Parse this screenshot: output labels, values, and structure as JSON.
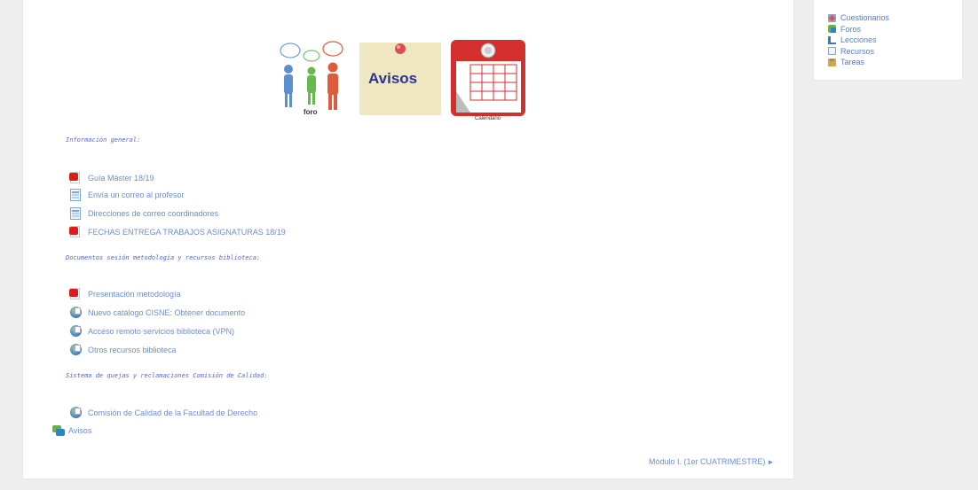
{
  "sidebar": {
    "items": [
      {
        "label": "Cuestionarios",
        "icon": "quiz-icon"
      },
      {
        "label": "Foros",
        "icon": "forum-icon"
      },
      {
        "label": "Lecciones",
        "icon": "lesson-icon"
      },
      {
        "label": "Recursos",
        "icon": "resource-icon"
      },
      {
        "label": "Tareas",
        "icon": "assignment-icon"
      }
    ]
  },
  "banner": {
    "foro_label": "foro",
    "avisos_label": "Avisos",
    "calendario_label": "Calendario"
  },
  "sections": [
    {
      "heading": "Información general:",
      "items": [
        {
          "label": "Guía Máster 18/19",
          "icon": "pdf-icon"
        },
        {
          "label": "Envía un correo al profesor",
          "icon": "page-icon"
        },
        {
          "label": "Direcciones de correo coordinadores",
          "icon": "page-icon"
        },
        {
          "label": "FECHAS ENTREGA TRABAJOS ASIGNATURAS 18/19",
          "icon": "pdf-icon"
        }
      ]
    },
    {
      "heading": "Documentos sesión metodología y recursos biblioteca:",
      "items": [
        {
          "label": "Presentación metodología",
          "icon": "pdf-icon"
        },
        {
          "label": "Nuevo catálogo CISNE: Obtener documento",
          "icon": "url-icon"
        },
        {
          "label": "Acceso remoto servicios biblioteca (VPN)",
          "icon": "url-icon"
        },
        {
          "label": "Otros recursos biblioteca",
          "icon": "url-icon"
        }
      ]
    },
    {
      "heading": "Sistema de quejas y reclamaciones Comisión de Calidad:",
      "items": [
        {
          "label": "Comisión de Calidad de la Facultad de Derecho",
          "icon": "url-icon"
        }
      ]
    }
  ],
  "avisos_link": {
    "label": "Avisos",
    "icon": "forum-icon"
  },
  "nav": {
    "next_label": "Módulo I. (1er CUATRIMESTRE)",
    "next_arrow": "►"
  },
  "colors": {
    "link": "#6b8fcc",
    "heading": "#5566dd",
    "background": "#eeeeee",
    "card": "#ffffff"
  }
}
